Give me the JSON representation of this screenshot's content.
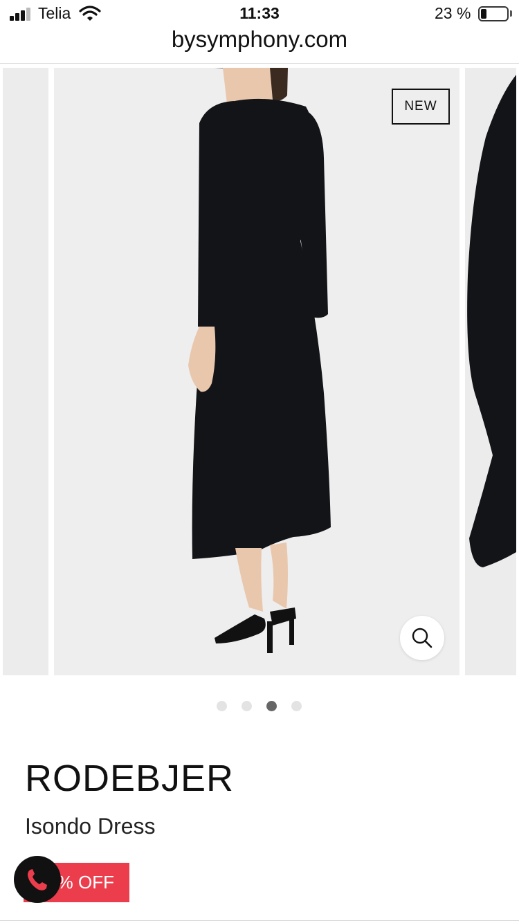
{
  "status_bar": {
    "carrier": "Telia",
    "time": "11:33",
    "battery_percent": "23 %",
    "battery_level": 0.23,
    "signal_bars": 3
  },
  "browser": {
    "url": "bysymphony.com"
  },
  "carousel": {
    "badge": "NEW",
    "slide_count": 4,
    "active_index": 2,
    "icons": {
      "zoom": "search-icon"
    }
  },
  "product": {
    "brand": "RODEBJER",
    "name": "Isondo Dress",
    "discount_label": "% OFF"
  },
  "chat": {
    "icon": "phone-icon"
  },
  "colors": {
    "discount_bg": "#ec3d4d",
    "dress": "#131417",
    "active_dot": "#666666"
  }
}
